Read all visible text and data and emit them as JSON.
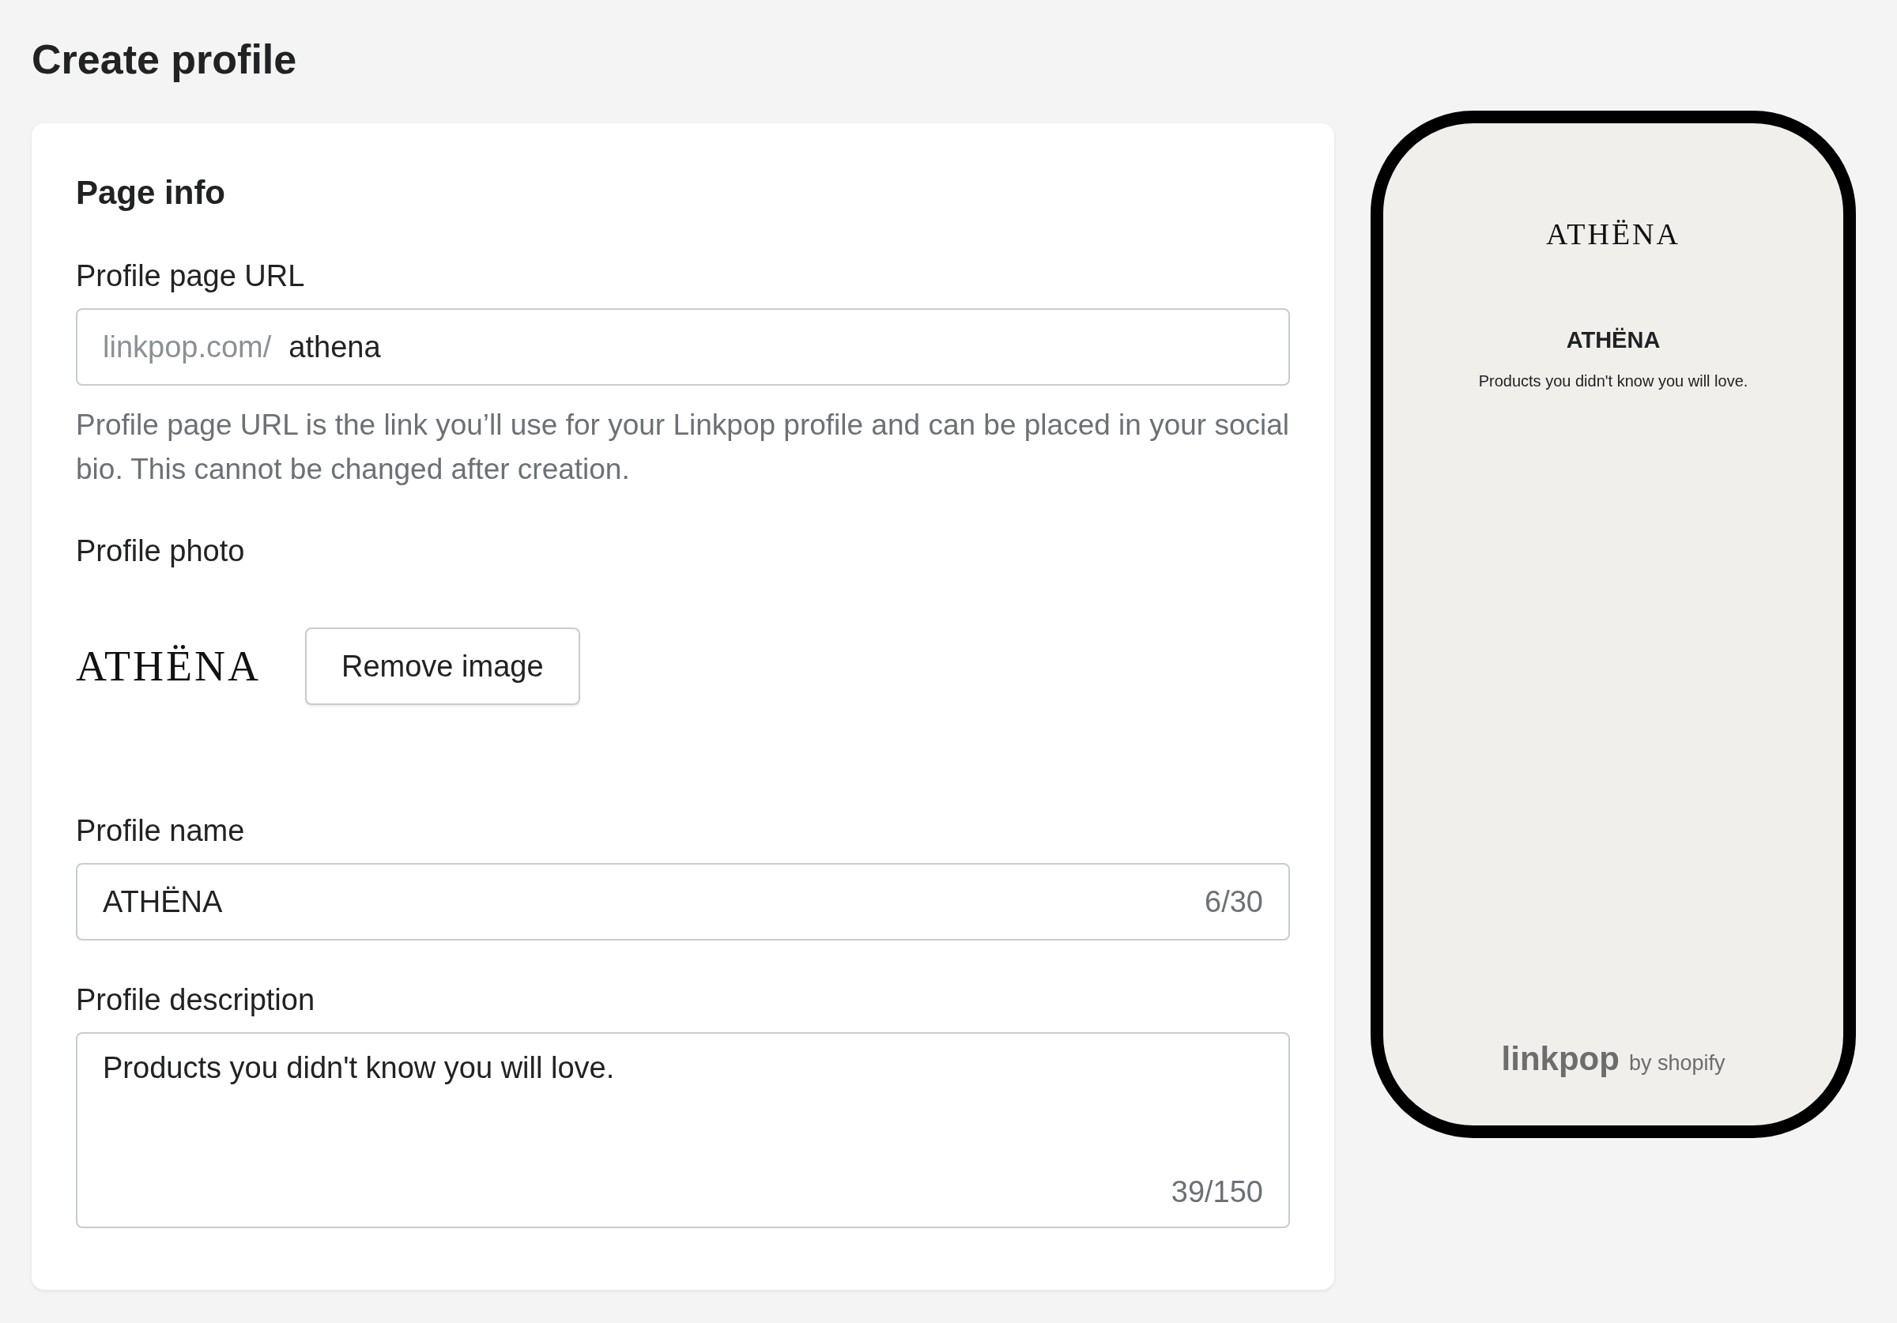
{
  "page_title": "Create profile",
  "card": {
    "heading": "Page info",
    "url_field": {
      "label": "Profile page URL",
      "prefix": "linkpop.com/",
      "value": "athena",
      "help": "Profile page URL is the link you’ll use for your Linkpop profile and can be placed in your social bio. This cannot be changed after creation."
    },
    "photo": {
      "label": "Profile photo",
      "logo": "ATHËNA",
      "button": "Remove image"
    },
    "name_field": {
      "label": "Profile name",
      "value": "ATHËNA",
      "count": "6/30"
    },
    "description_field": {
      "label": "Profile description",
      "value": "Products you didn't know you will love.",
      "count": "39/150"
    }
  },
  "preview": {
    "logo": "ATHËNA",
    "name": "ATHËNA",
    "description": "Products you didn't know you will love.",
    "brand": "linkpop",
    "brand_suffix": "by shopify"
  }
}
